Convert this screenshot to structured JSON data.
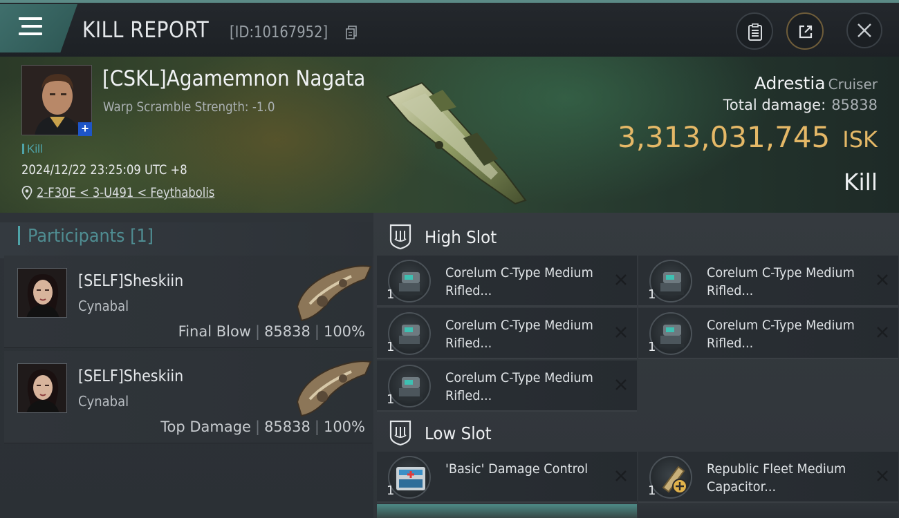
{
  "header": {
    "title": "KILL REPORT",
    "report_id": "[ID:10167952]"
  },
  "victim": {
    "name": "[CSKL]Agamemnon Nagata",
    "warp_scramble": "Warp Scramble Strength: -1.0",
    "kill_tag": "Kill",
    "datetime": "2024/12/22 23:25:09 UTC +8",
    "location": "2-F30E < 3-U491 < Feythabolis",
    "ship_name": "Adrestia",
    "ship_class": "Cruiser",
    "total_damage_label": "Total damage:",
    "total_damage": "85838",
    "isk_value": "3,313,031,745",
    "isk_unit": "ISK",
    "result": "Kill"
  },
  "participants": {
    "title": "Participants [1]",
    "items": [
      {
        "name": "[SELF]Sheskiin",
        "ship": "Cynabal",
        "role": "Final Blow",
        "damage": "85838",
        "percent": "100%"
      },
      {
        "name": "[SELF]Sheskiin",
        "ship": "Cynabal",
        "role": "Top Damage",
        "damage": "85838",
        "percent": "100%"
      }
    ],
    "separator": "|"
  },
  "fittings": {
    "high_slot": {
      "title": "High Slot",
      "modules": [
        {
          "qty": "1",
          "name": "Corelum C-Type Medium Rifled..."
        },
        {
          "qty": "1",
          "name": "Corelum C-Type Medium Rifled..."
        },
        {
          "qty": "1",
          "name": "Corelum C-Type Medium Rifled..."
        },
        {
          "qty": "1",
          "name": "Corelum C-Type Medium Rifled..."
        },
        {
          "qty": "1",
          "name": "Corelum C-Type Medium Rifled..."
        }
      ]
    },
    "low_slot": {
      "title": "Low Slot",
      "modules": [
        {
          "qty": "1",
          "name": "'Basic' Damage Control"
        },
        {
          "qty": "1",
          "name": "Republic Fleet Medium Capacitor..."
        }
      ]
    }
  },
  "icons": {
    "menu": "menu-icon",
    "copy": "copy-icon",
    "clipboard": "clipboard-icon",
    "share": "share-icon",
    "close": "close-icon",
    "location": "location-pin-icon",
    "slot": "slot-shield-icon",
    "remove": "x-icon"
  },
  "colors": {
    "accent_teal": "#4fa3a8",
    "isk_gold": "#e5b867",
    "share_ring": "#6f5d3a"
  }
}
